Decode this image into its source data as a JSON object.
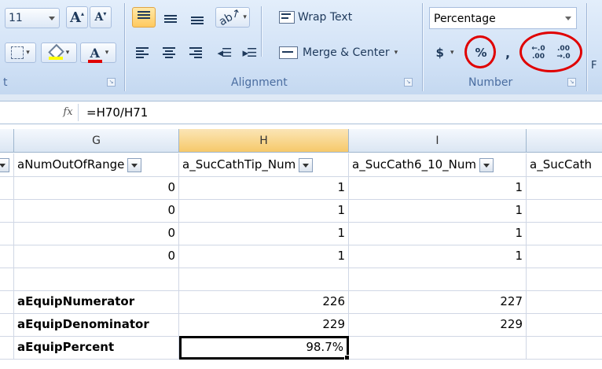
{
  "ribbon": {
    "font_size": "11",
    "grow_font": "A",
    "shrink_font": "A",
    "font_color_letter": "A",
    "font_group_label": "t",
    "wrap_text": "Wrap Text",
    "merge_center": "Merge & Center",
    "alignment_label": "Alignment",
    "number_format": "Percentage",
    "currency": "$",
    "percent": "%",
    "comma": ",",
    "increase_decimal_top": "←.0",
    "increase_decimal_bottom": ".00",
    "decrease_decimal_top": ".00",
    "decrease_decimal_bottom": "→.0",
    "number_label": "Number",
    "edge_letter": "F",
    "accent_red": "#e00000"
  },
  "formula_bar": {
    "fx": "fx",
    "formula": "=H70/H71"
  },
  "sheet": {
    "columns": [
      "G",
      "H",
      "I"
    ],
    "header_row": [
      "aNumOutOfRange",
      "a_SucCathTip_Num",
      "a_SucCath6_10_Num",
      "a_SucCath"
    ],
    "data_rows": [
      [
        "0",
        "1",
        "1"
      ],
      [
        "0",
        "1",
        "1"
      ],
      [
        "0",
        "1",
        "1"
      ],
      [
        "0",
        "1",
        "1"
      ]
    ],
    "summary_rows": [
      {
        "label": "aEquipNumerator",
        "h": "226",
        "i": "227"
      },
      {
        "label": "aEquipDenominator",
        "h": "229",
        "i": "229"
      },
      {
        "label": "aEquipPercent",
        "h": "98.7%",
        "i": ""
      }
    ]
  }
}
